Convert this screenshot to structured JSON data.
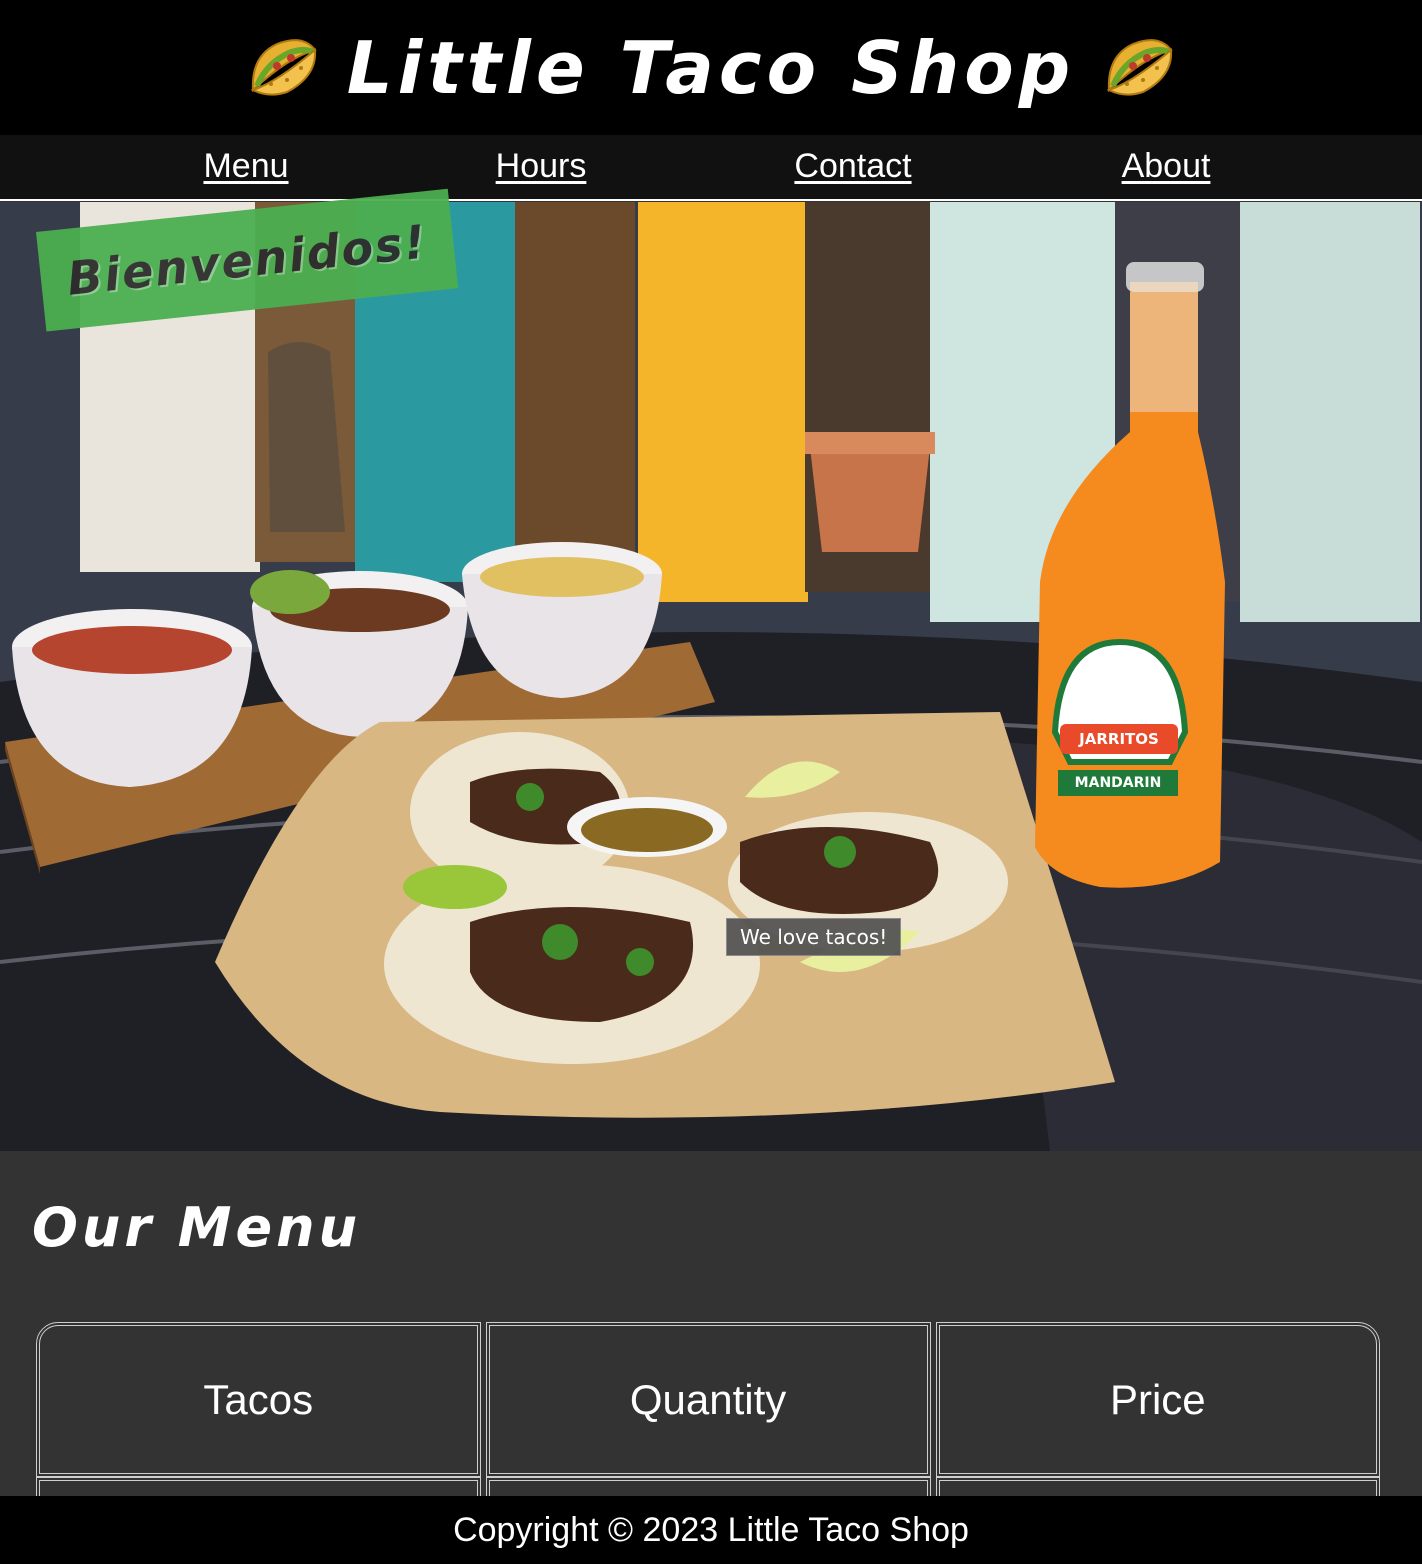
{
  "header": {
    "title": "Little Taco Shop",
    "left_icon": "taco-icon",
    "right_icon": "taco-icon"
  },
  "nav": {
    "items": [
      {
        "label": "Menu"
      },
      {
        "label": "Hours"
      },
      {
        "label": "Contact"
      },
      {
        "label": "About"
      }
    ]
  },
  "hero": {
    "banner_text": "Bienvenidos!",
    "caption": "We love tacos!",
    "bottle_label_brand": "JARRITOS",
    "bottle_label_flavor": "MANDARIN",
    "banner_color": "#4caf50"
  },
  "menu": {
    "heading": "Our Menu",
    "columns": [
      "Tacos",
      "Quantity",
      "Price"
    ]
  },
  "footer": {
    "text": "Copyright © 2023 Little Taco Shop"
  },
  "colors": {
    "header_bg": "#000000",
    "nav_bg": "#111111",
    "page_bg": "#333333"
  }
}
